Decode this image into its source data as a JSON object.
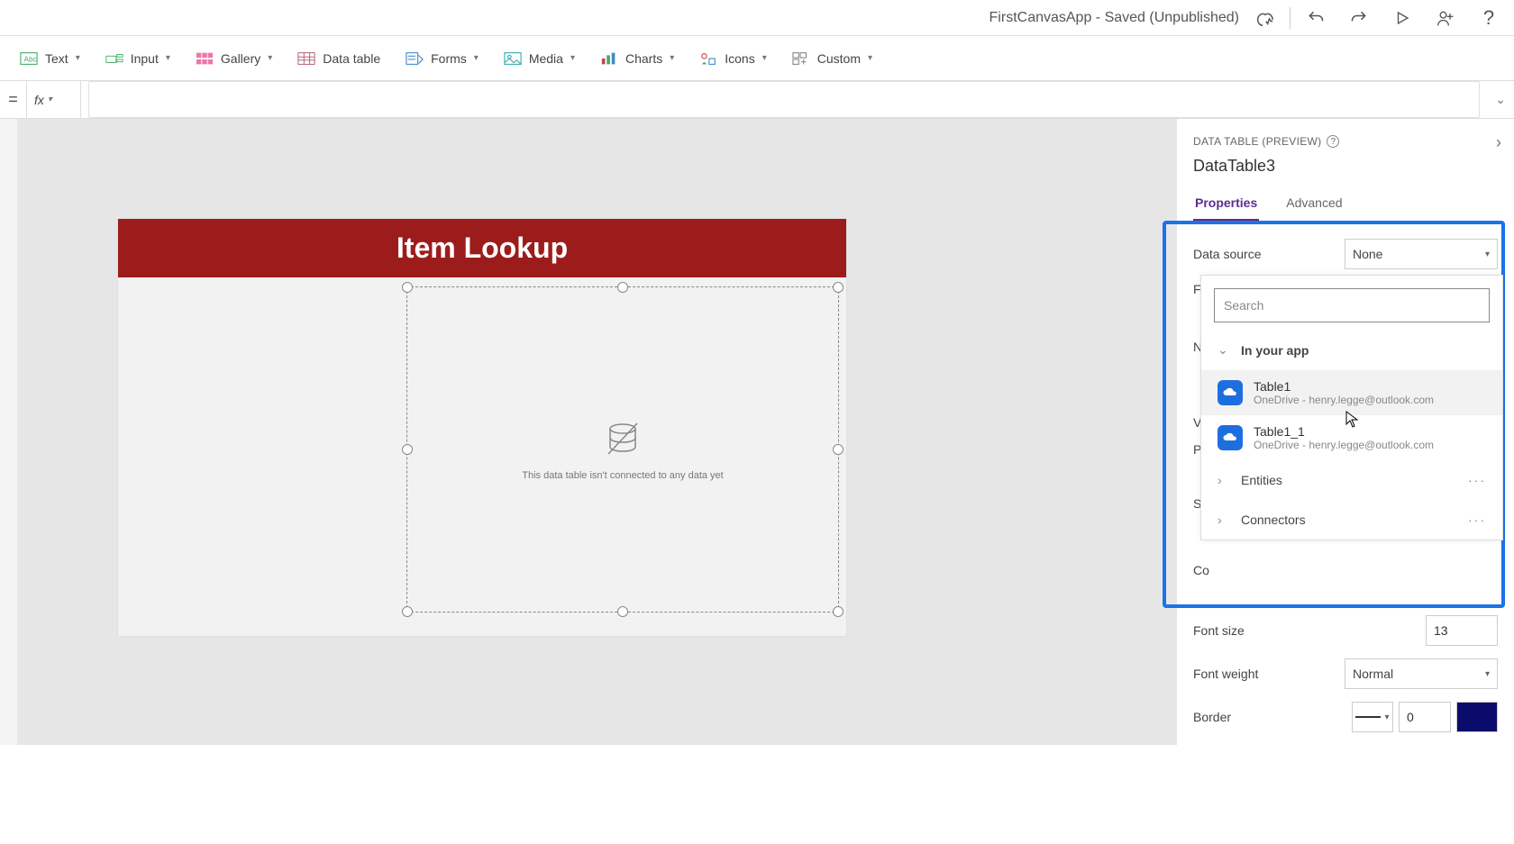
{
  "titlebar": {
    "title": "FirstCanvasApp - Saved (Unpublished)"
  },
  "ribbon": {
    "text": "Text",
    "input": "Input",
    "gallery": "Gallery",
    "datatable": "Data table",
    "forms": "Forms",
    "media": "Media",
    "charts": "Charts",
    "icons": "Icons",
    "custom": "Custom"
  },
  "formulabar": {
    "eq": "=",
    "fx": "fx"
  },
  "canvas": {
    "page_title": "Item Lookup",
    "empty_msg": "This data table isn't connected to any data yet"
  },
  "rpanel": {
    "caption": "DATA TABLE (PREVIEW)",
    "control_name": "DataTable3",
    "tab_properties": "Properties",
    "tab_advanced": "Advanced",
    "rows": {
      "data_source": "Data source",
      "data_source_value": "None",
      "fields": "Fie",
      "no": "No",
      "visible": "Vis",
      "position": "Po",
      "size": "Siz",
      "color": "Co"
    },
    "font_size_label": "Font size",
    "font_size_value": "13",
    "font_weight_label": "Font weight",
    "font_weight_value": "Normal",
    "border_label": "Border",
    "border_value": "0"
  },
  "popup": {
    "search_placeholder": "Search",
    "section_inapp": "In your app",
    "items": [
      {
        "name": "Table1",
        "sub": "OneDrive - henry.legge@outlook.com"
      },
      {
        "name": "Table1_1",
        "sub": "OneDrive - henry.legge@outlook.com"
      }
    ],
    "section_entities": "Entities",
    "section_connectors": "Connectors"
  }
}
